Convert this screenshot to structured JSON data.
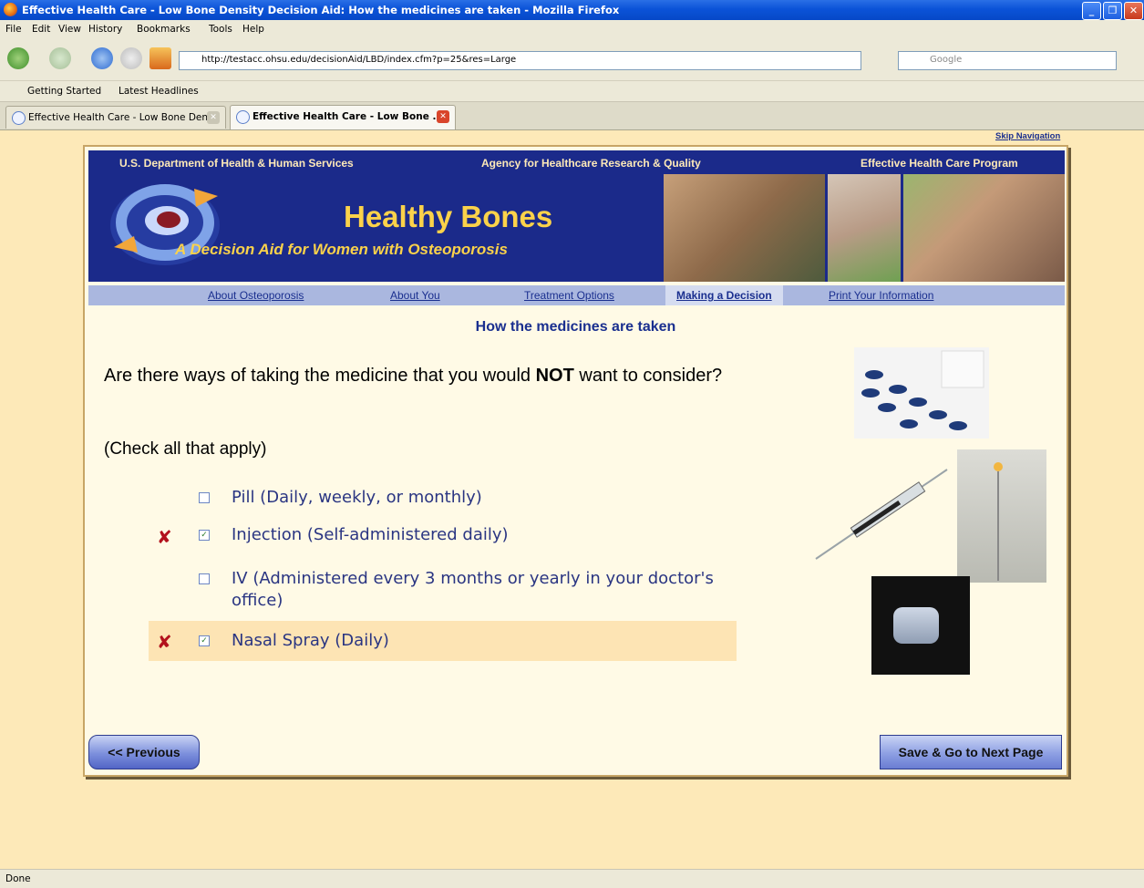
{
  "browser": {
    "window_title": "Effective Health Care - Low Bone Density Decision Aid: How the medicines are taken - Mozilla Firefox",
    "menu": [
      "File",
      "Edit",
      "View",
      "History",
      "Bookmarks",
      "Tools",
      "Help"
    ],
    "url": "http://testacc.ohsu.edu/decisionAid/LBD/index.cfm?p=25&res=Large",
    "search_placeholder": "Google",
    "bookmarks": [
      "Getting Started",
      "Latest Headlines"
    ],
    "tabs": [
      {
        "label": "Effective Health Care - Low Bone Den...",
        "active": false
      },
      {
        "label": "Effective Health Care - Low Bone ...",
        "active": true
      }
    ],
    "status": "Done"
  },
  "page": {
    "skip_nav": "Skip Navigation",
    "header": {
      "dept": "U.S. Department of Health & Human Services",
      "agency": "Agency for Healthcare Research & Quality",
      "program": "Effective Health Care Program",
      "title": "Healthy Bones",
      "subtitle": "A Decision Aid for Women with Osteoporosis"
    },
    "nav": [
      "About Osteoporosis",
      "About You",
      "Treatment Options",
      "Making a Decision",
      "Print Your Information"
    ],
    "active_nav": "Making a Decision",
    "section_title": "How the medicines are taken",
    "question_pre": "Are there ways of taking the medicine that you would ",
    "question_emph": "NOT",
    "question_post": " want to consider?",
    "instruction": "(Check all that apply)",
    "options": [
      {
        "label": "Pill (Daily, weekly, or monthly)",
        "checked": false,
        "excluded": false
      },
      {
        "label": "Injection (Self-administered daily)",
        "checked": true,
        "excluded": true
      },
      {
        "label": "IV (Administered every 3 months or yearly in your doctor's office)",
        "checked": false,
        "excluded": false
      },
      {
        "label": "Nasal Spray (Daily)",
        "checked": true,
        "excluded": true
      }
    ],
    "prev_button": "<< Previous",
    "next_button": "Save & Go to Next Page"
  }
}
